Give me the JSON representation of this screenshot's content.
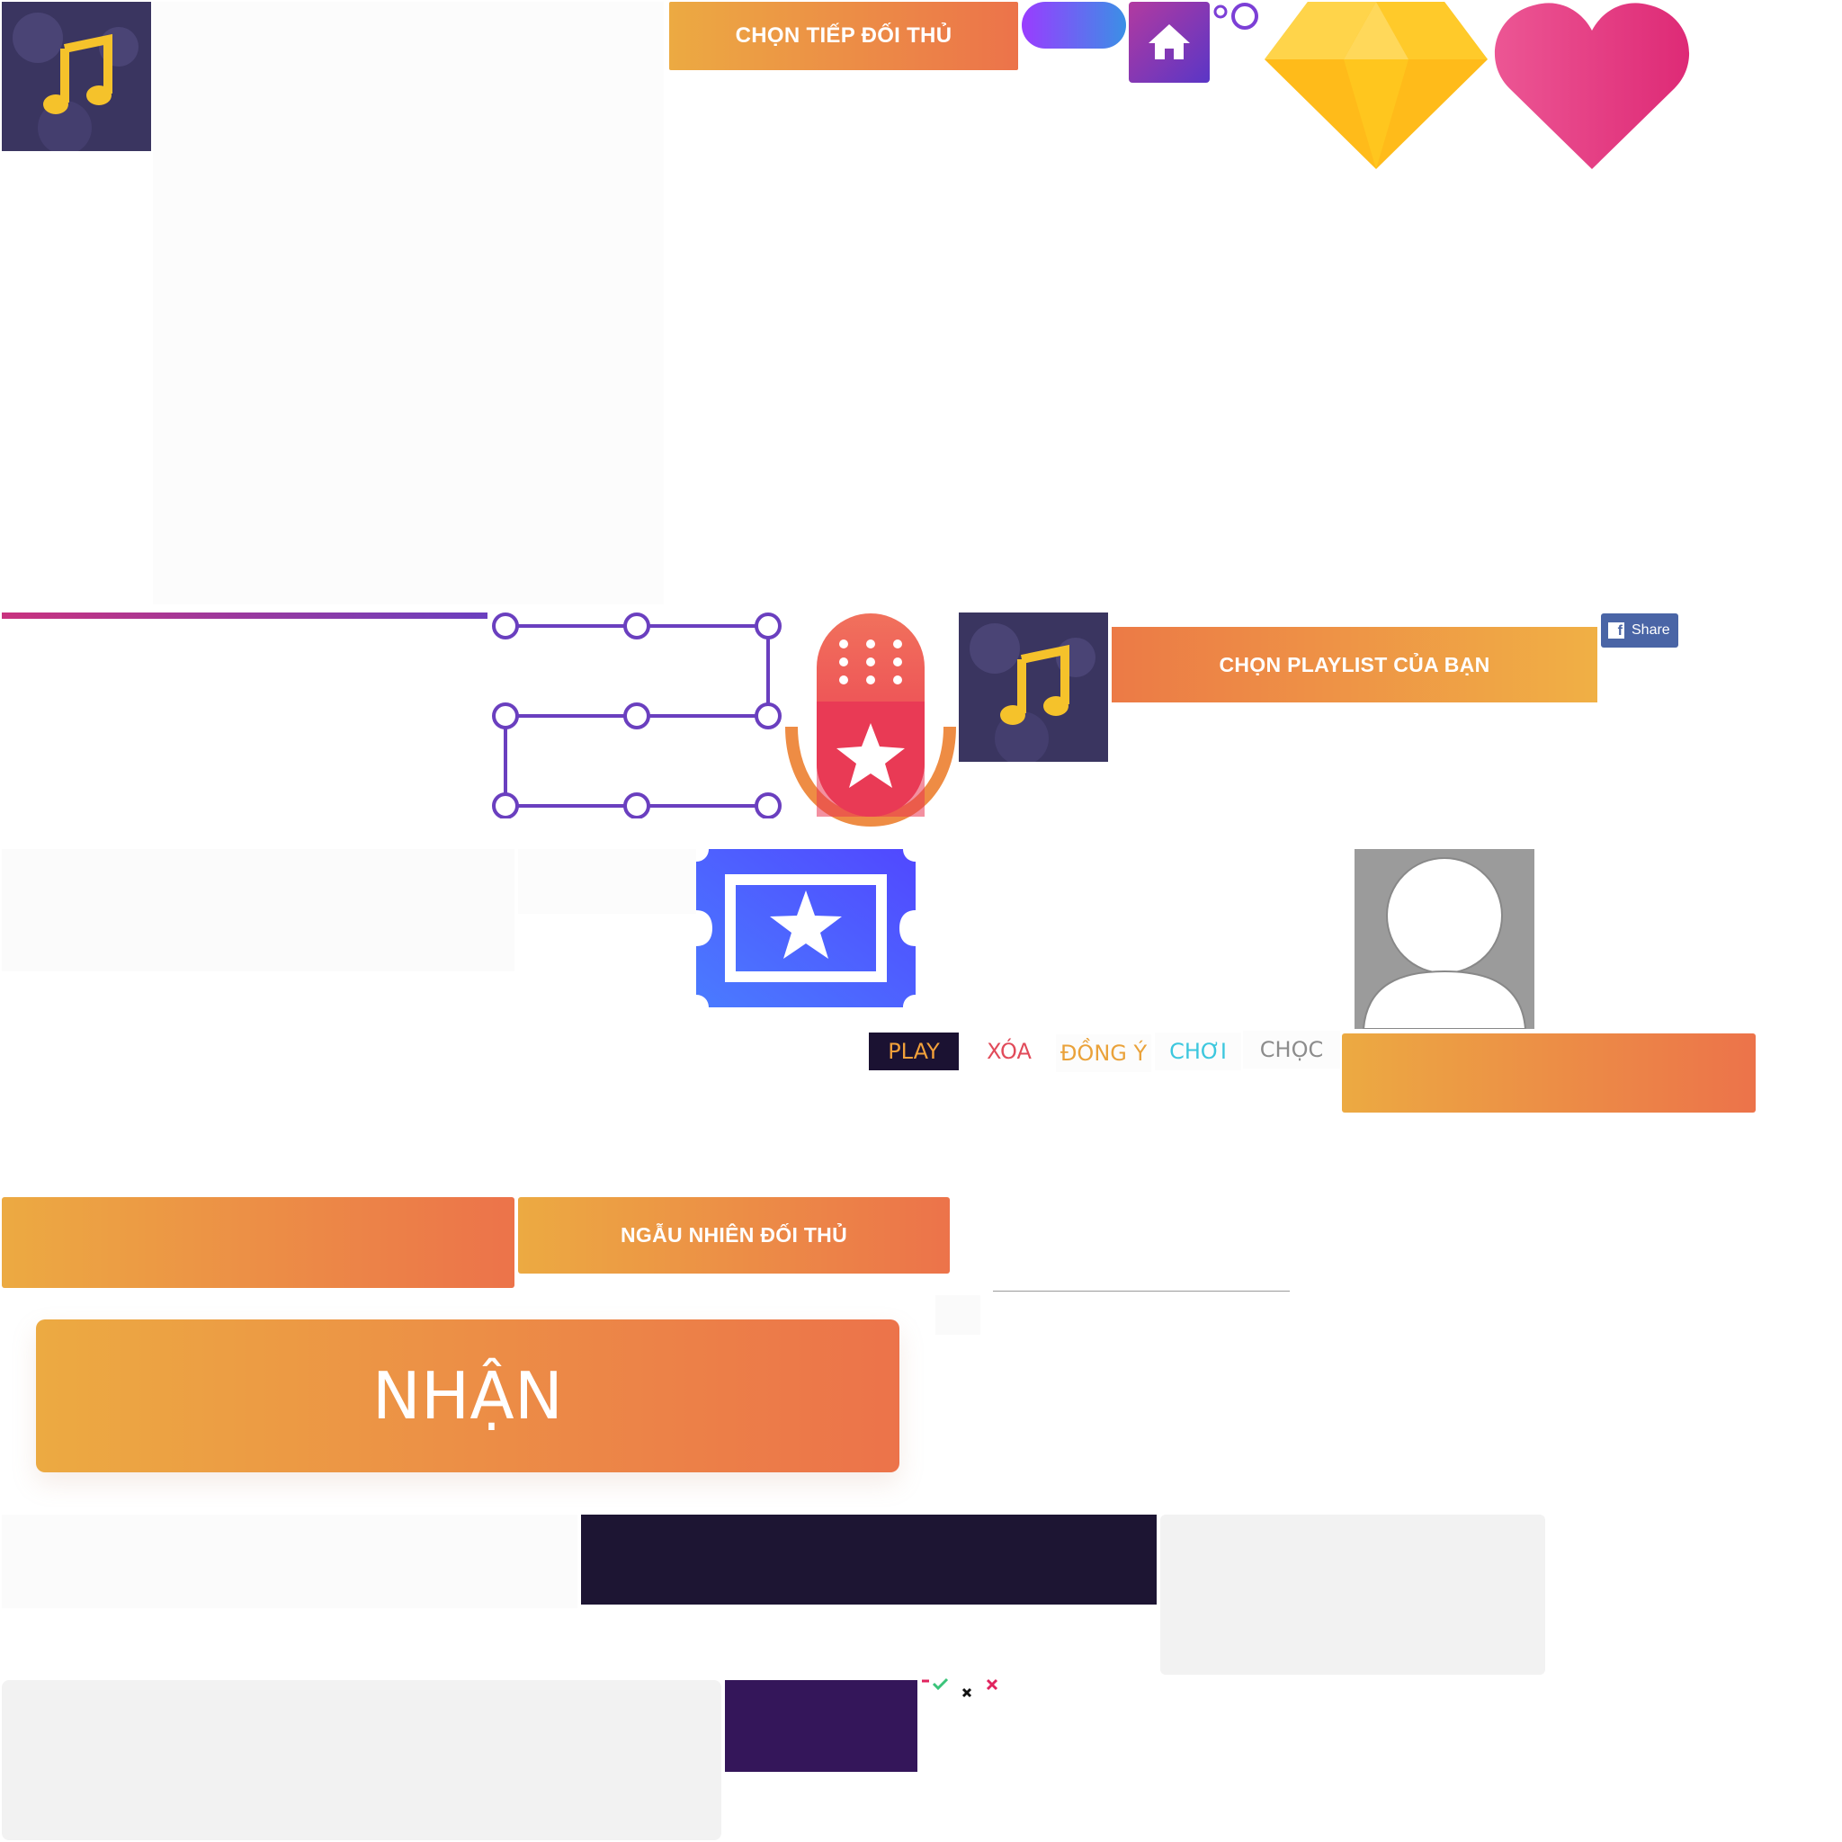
{
  "colors": {
    "orange_start": "#ecaa42",
    "orange_end": "#ec734a",
    "purple": "#6a3fbf",
    "dark_navy": "#1d1533",
    "dark_purple": "#34165a",
    "diamond": "#ffbb1a",
    "heart": "#e6407a",
    "ticket_blue": "#4d5cff",
    "mic_red": "#ec3d56",
    "mic_stand": "#ee8c44",
    "fb_blue": "#3b5998"
  },
  "buttons": {
    "chon_tiep_doi_thu": "CHỌN TIẾP ĐỐI THỦ",
    "chon_playlist": "CHỌN PLAYLIST CỦA BẠN",
    "ngau_nhien_doi_thu": "NGẪU NHIÊN ĐỐI THỦ",
    "nhan": "NHẬN",
    "fb_share": "Share"
  },
  "word_tabs": {
    "play": "PLAY",
    "xoa": "XÓA",
    "dong_y": "ĐỒNG Ý",
    "choi": "CHƠI",
    "choc": "CHỌC"
  },
  "icons": {
    "music_tile": "music-note-icon",
    "home": "home-icon",
    "diamond": "diamond-icon",
    "heart": "heart-icon",
    "microphone": "microphone-star-icon",
    "ticket": "ticket-star-icon",
    "avatar": "avatar-placeholder-icon",
    "facebook": "facebook-icon",
    "check": "check-icon",
    "close": "close-icon"
  }
}
